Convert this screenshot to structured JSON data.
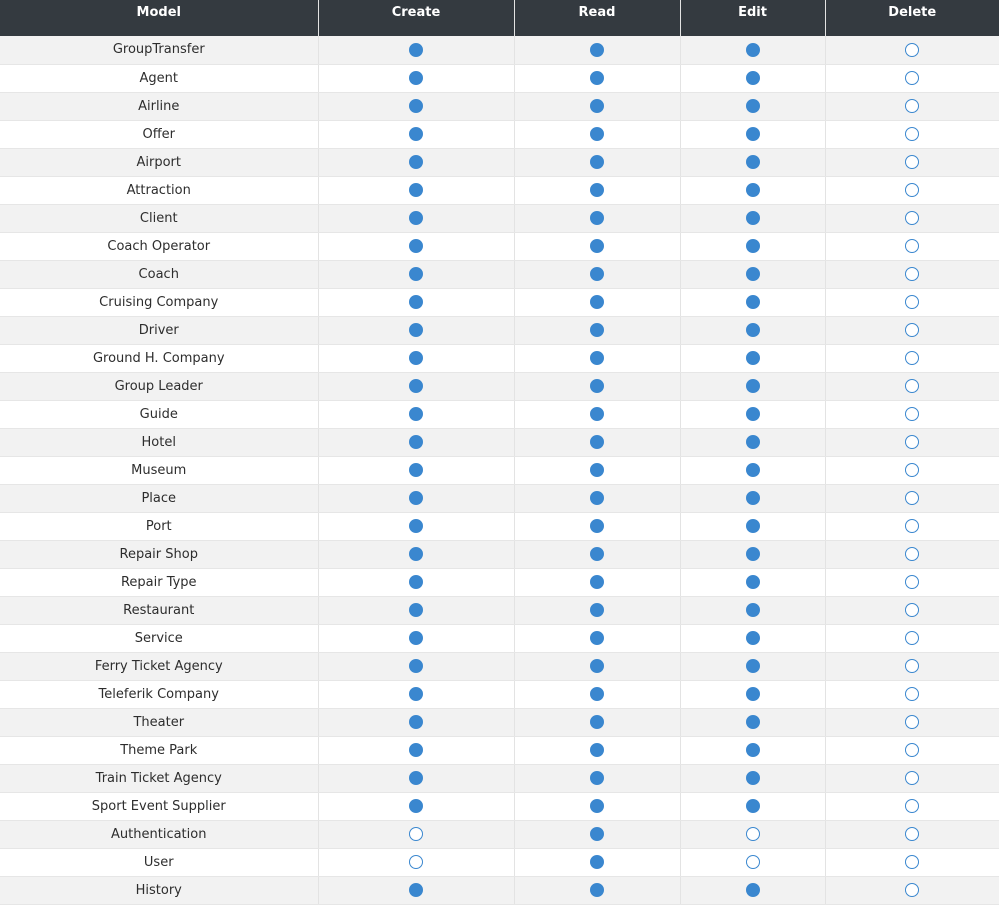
{
  "table": {
    "headers": {
      "model": "Model",
      "create": "Create",
      "read": "Read",
      "edit": "Edit",
      "delete": "Delete"
    },
    "rows": [
      {
        "model": "GroupTransfer",
        "create": true,
        "read": true,
        "edit": true,
        "delete": false
      },
      {
        "model": "Agent",
        "create": true,
        "read": true,
        "edit": true,
        "delete": false
      },
      {
        "model": "Airline",
        "create": true,
        "read": true,
        "edit": true,
        "delete": false
      },
      {
        "model": "Offer",
        "create": true,
        "read": true,
        "edit": true,
        "delete": false
      },
      {
        "model": "Airport",
        "create": true,
        "read": true,
        "edit": true,
        "delete": false
      },
      {
        "model": "Attraction",
        "create": true,
        "read": true,
        "edit": true,
        "delete": false
      },
      {
        "model": "Client",
        "create": true,
        "read": true,
        "edit": true,
        "delete": false
      },
      {
        "model": "Coach Operator",
        "create": true,
        "read": true,
        "edit": true,
        "delete": false
      },
      {
        "model": "Coach",
        "create": true,
        "read": true,
        "edit": true,
        "delete": false
      },
      {
        "model": "Cruising Company",
        "create": true,
        "read": true,
        "edit": true,
        "delete": false
      },
      {
        "model": "Driver",
        "create": true,
        "read": true,
        "edit": true,
        "delete": false
      },
      {
        "model": "Ground H. Company",
        "create": true,
        "read": true,
        "edit": true,
        "delete": false
      },
      {
        "model": "Group Leader",
        "create": true,
        "read": true,
        "edit": true,
        "delete": false
      },
      {
        "model": "Guide",
        "create": true,
        "read": true,
        "edit": true,
        "delete": false
      },
      {
        "model": "Hotel",
        "create": true,
        "read": true,
        "edit": true,
        "delete": false
      },
      {
        "model": "Museum",
        "create": true,
        "read": true,
        "edit": true,
        "delete": false
      },
      {
        "model": "Place",
        "create": true,
        "read": true,
        "edit": true,
        "delete": false
      },
      {
        "model": "Port",
        "create": true,
        "read": true,
        "edit": true,
        "delete": false
      },
      {
        "model": "Repair Shop",
        "create": true,
        "read": true,
        "edit": true,
        "delete": false
      },
      {
        "model": "Repair Type",
        "create": true,
        "read": true,
        "edit": true,
        "delete": false
      },
      {
        "model": "Restaurant",
        "create": true,
        "read": true,
        "edit": true,
        "delete": false
      },
      {
        "model": "Service",
        "create": true,
        "read": true,
        "edit": true,
        "delete": false
      },
      {
        "model": "Ferry Ticket Agency",
        "create": true,
        "read": true,
        "edit": true,
        "delete": false
      },
      {
        "model": "Teleferik Company",
        "create": true,
        "read": true,
        "edit": true,
        "delete": false
      },
      {
        "model": "Theater",
        "create": true,
        "read": true,
        "edit": true,
        "delete": false
      },
      {
        "model": "Theme Park",
        "create": true,
        "read": true,
        "edit": true,
        "delete": false
      },
      {
        "model": "Train Ticket Agency",
        "create": true,
        "read": true,
        "edit": true,
        "delete": false
      },
      {
        "model": "Sport Event Supplier",
        "create": true,
        "read": true,
        "edit": true,
        "delete": false
      },
      {
        "model": "Authentication",
        "create": false,
        "read": true,
        "edit": false,
        "delete": false
      },
      {
        "model": "User",
        "create": false,
        "read": true,
        "edit": false,
        "delete": false
      },
      {
        "model": "History",
        "create": true,
        "read": true,
        "edit": true,
        "delete": false
      }
    ]
  },
  "colors": {
    "header_bg": "#343a40",
    "accent": "#3a87cf",
    "row_alt": "#f2f2f2"
  }
}
